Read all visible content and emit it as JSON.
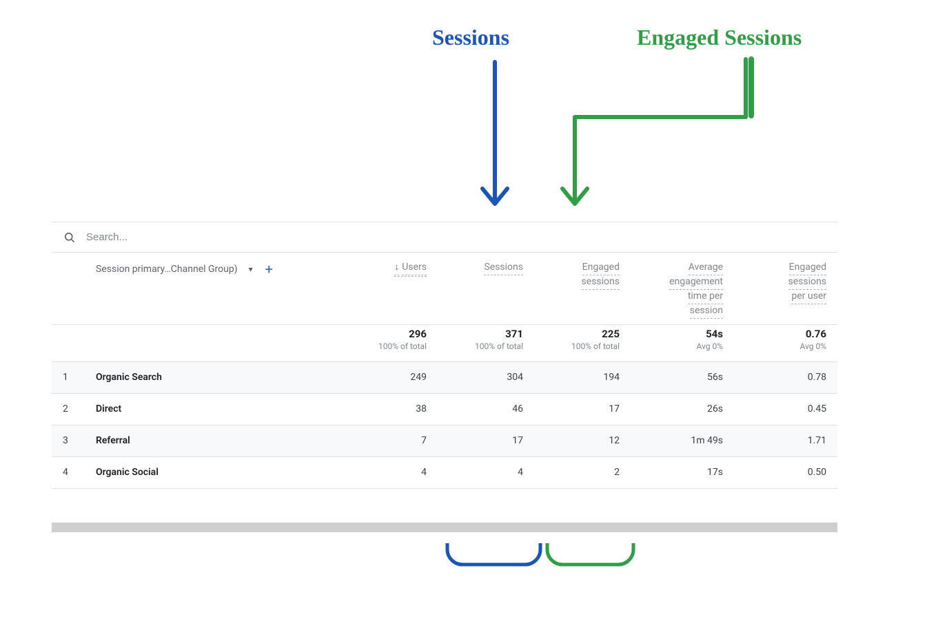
{
  "annotations": {
    "sessions_label": "Sessions",
    "engaged_label": "Engaged Sessions",
    "colors": {
      "sessions": "#1a56b8",
      "engaged": "#2f9e44"
    }
  },
  "search": {
    "placeholder": "Search..."
  },
  "table": {
    "dimension_label": "Session primary…Channel Group)",
    "columns": {
      "users": {
        "label": "Users",
        "sorted_desc": true
      },
      "sessions": {
        "label": "Sessions"
      },
      "engaged_sessions": {
        "lines": [
          "Engaged",
          "sessions"
        ]
      },
      "avg_engagement": {
        "lines": [
          "Average",
          "engagement",
          "time per",
          "session"
        ]
      },
      "engaged_per_user": {
        "lines": [
          "Engaged",
          "sessions",
          "per user"
        ]
      }
    },
    "totals": {
      "users": {
        "value": "296",
        "sub": "100% of total"
      },
      "sessions": {
        "value": "371",
        "sub": "100% of total"
      },
      "engaged_sessions": {
        "value": "225",
        "sub": "100% of total"
      },
      "avg_engagement": {
        "value": "54s",
        "sub": "Avg 0%"
      },
      "engaged_per_user": {
        "value": "0.76",
        "sub": "Avg 0%"
      }
    },
    "rows": [
      {
        "n": "1",
        "dim": "Organic Search",
        "users": "249",
        "sessions": "304",
        "engaged": "194",
        "avg": "56s",
        "per": "0.78"
      },
      {
        "n": "2",
        "dim": "Direct",
        "users": "38",
        "sessions": "46",
        "engaged": "17",
        "avg": "26s",
        "per": "0.45"
      },
      {
        "n": "3",
        "dim": "Referral",
        "users": "7",
        "sessions": "17",
        "engaged": "12",
        "avg": "1m 49s",
        "per": "1.71"
      },
      {
        "n": "4",
        "dim": "Organic Social",
        "users": "4",
        "sessions": "4",
        "engaged": "2",
        "avg": "17s",
        "per": "0.50"
      }
    ]
  }
}
